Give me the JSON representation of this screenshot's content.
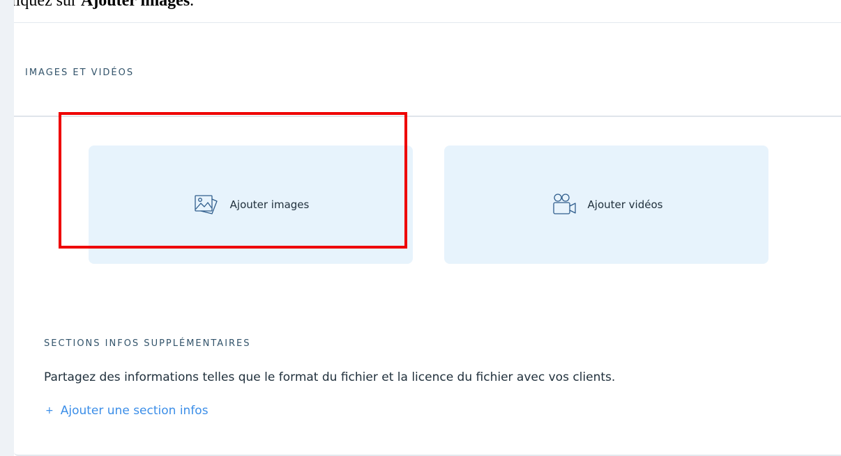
{
  "instruction": {
    "prefix": "Cliquez sur ",
    "target": "Ajouter images",
    "suffix": "."
  },
  "media_section": {
    "title": "IMAGES ET VIDÉOS",
    "cards": [
      {
        "label": "Ajouter images",
        "icon": "add-images-icon",
        "highlighted": true
      },
      {
        "label": "Ajouter vidéos",
        "icon": "add-videos-icon",
        "highlighted": false
      }
    ]
  },
  "extra_info": {
    "title": "SECTIONS INFOS SUPPLÉMENTAIRES",
    "description": "Partagez des informations telles que le format du fichier et la licence du fichier avec vos clients.",
    "add_link_icon": "+",
    "add_link_label": "Ajouter une section infos"
  },
  "colors": {
    "highlight": "#ee0000",
    "card_background": "#e7f3fc",
    "link": "#3b8ee8"
  }
}
